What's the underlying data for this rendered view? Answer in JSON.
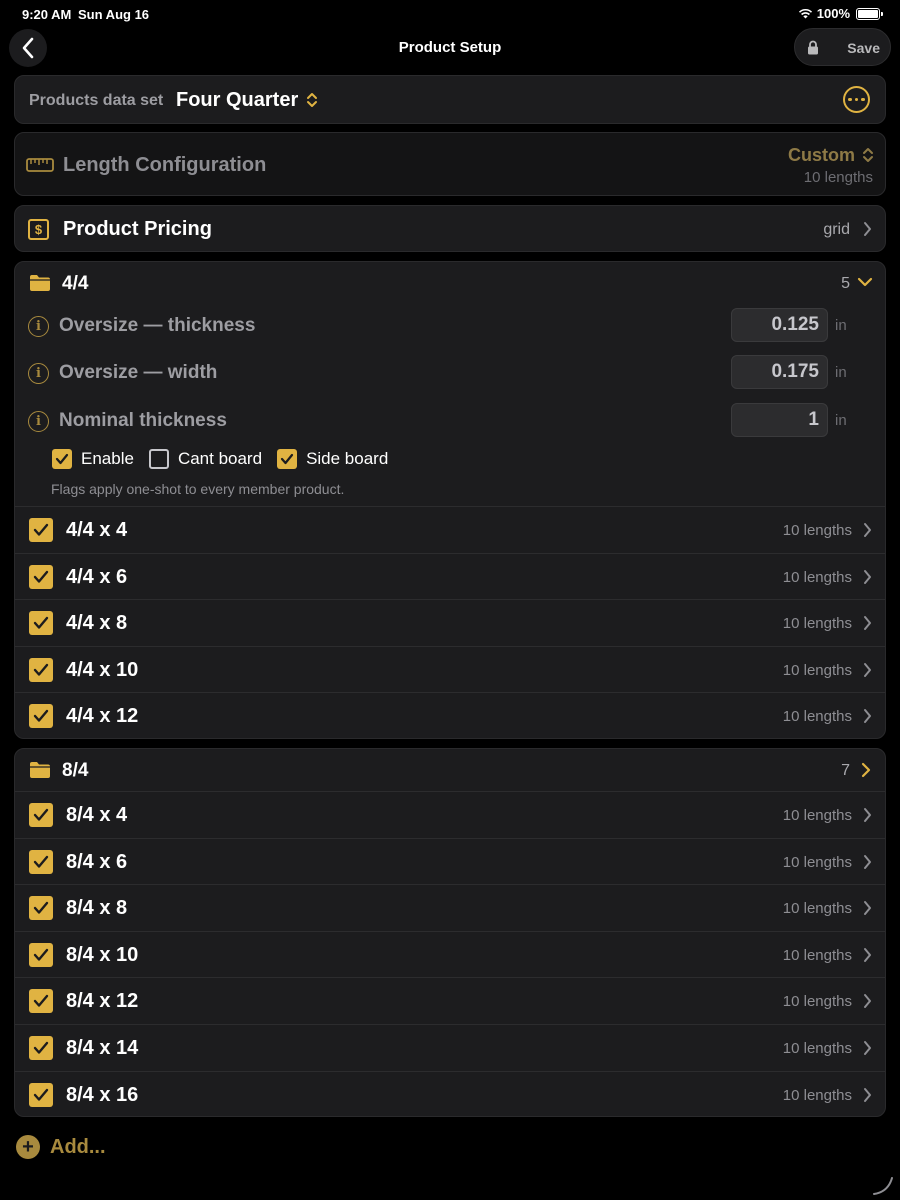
{
  "status": {
    "time": "9:20 AM",
    "date": "Sun Aug 16",
    "battery": "100%",
    "battery_level": 1.0
  },
  "nav": {
    "title": "Product Setup",
    "save_label": "Save"
  },
  "dataset": {
    "label": "Products data set",
    "value": "Four Quarter"
  },
  "length_config": {
    "label": "Length Configuration",
    "value": "Custom",
    "sub": "10 lengths"
  },
  "pricing": {
    "label": "Product Pricing",
    "value": "grid"
  },
  "groups": [
    {
      "title": "4/4",
      "count": "5",
      "expanded": true,
      "params": [
        {
          "label": "Oversize — thickness",
          "value": "0.125",
          "unit": "in"
        },
        {
          "label": "Oversize — width",
          "value": "0.175",
          "unit": "in"
        },
        {
          "label": "Nominal thickness",
          "value": "1",
          "unit": "in"
        }
      ],
      "flags": [
        {
          "label": "Enable",
          "checked": true
        },
        {
          "label": "Cant board",
          "checked": false
        },
        {
          "label": "Side board",
          "checked": true
        }
      ],
      "flags_note": "Flags apply one-shot to every member product.",
      "products": [
        {
          "name": "4/4 x 4",
          "meta": "10 lengths",
          "checked": true
        },
        {
          "name": "4/4 x 6",
          "meta": "10 lengths",
          "checked": true
        },
        {
          "name": "4/4 x 8",
          "meta": "10 lengths",
          "checked": true
        },
        {
          "name": "4/4 x 10",
          "meta": "10 lengths",
          "checked": true
        },
        {
          "name": "4/4 x 12",
          "meta": "10 lengths",
          "checked": true
        }
      ]
    },
    {
      "title": "8/4",
      "count": "7",
      "expanded": false,
      "products": [
        {
          "name": "8/4 x 4",
          "meta": "10 lengths",
          "checked": true
        },
        {
          "name": "8/4 x 6",
          "meta": "10 lengths",
          "checked": true
        },
        {
          "name": "8/4 x 8",
          "meta": "10 lengths",
          "checked": true
        },
        {
          "name": "8/4 x 10",
          "meta": "10 lengths",
          "checked": true
        },
        {
          "name": "8/4 x 12",
          "meta": "10 lengths",
          "checked": true
        },
        {
          "name": "8/4 x 14",
          "meta": "10 lengths",
          "checked": true
        },
        {
          "name": "8/4 x 16",
          "meta": "10 lengths",
          "checked": true
        }
      ]
    }
  ],
  "add_label": "Add...",
  "colors": {
    "accent": "#e0b342",
    "background": "#000000",
    "card": "#1c1c1e"
  }
}
